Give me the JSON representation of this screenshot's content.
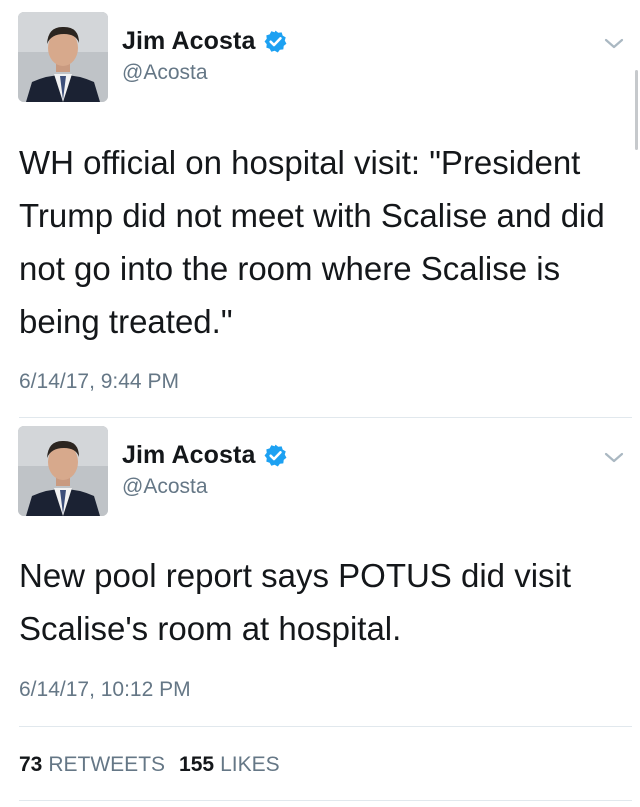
{
  "tweets": [
    {
      "display_name": "Jim Acosta",
      "handle": "@Acosta",
      "text": "WH official on hospital visit: \"President Trump did not meet with Scalise and did not go into the room where Scalise is being treated.\"",
      "timestamp": "6/14/17, 9:44 PM",
      "icons": {
        "verified": "verified-badge-icon",
        "menu": "chevron-down-icon"
      }
    },
    {
      "display_name": "Jim Acosta",
      "handle": "@Acosta",
      "text": "New pool report says POTUS did visit Scalise's room at hospital.",
      "timestamp": "6/14/17, 10:12 PM",
      "icons": {
        "verified": "verified-badge-icon",
        "menu": "chevron-down-icon"
      }
    }
  ],
  "stats": {
    "retweets_count": "73",
    "retweets_label": "RETWEETS",
    "likes_count": "155",
    "likes_label": "LIKES"
  },
  "colors": {
    "verified_blue": "#1da1f2",
    "secondary_text": "#657786",
    "divider": "#e1e8ed"
  }
}
